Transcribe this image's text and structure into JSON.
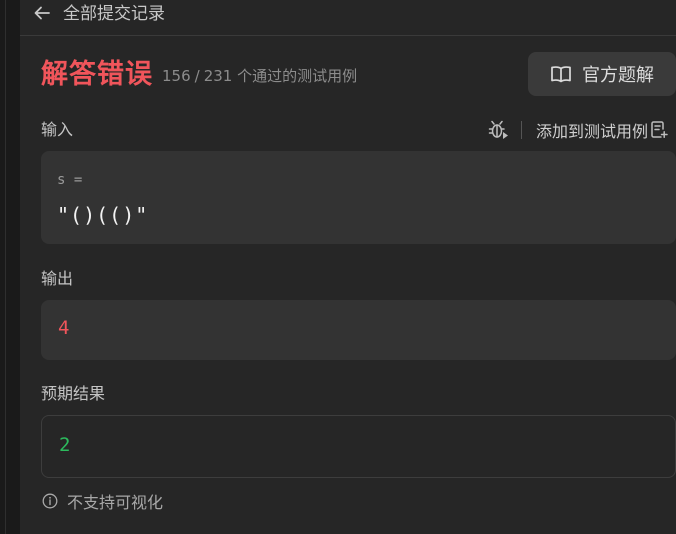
{
  "header": {
    "back_icon": "arrow-left-icon",
    "title": "全部提交记录"
  },
  "result": {
    "status": "解答错误",
    "passed": "156",
    "total": "231",
    "passed_suffix": "个通过的测试用例",
    "status_color": "#f0555b"
  },
  "official_solution": {
    "icon": "book-icon",
    "label": "官方题解"
  },
  "input_section": {
    "label": "输入",
    "debug_icon": "bug-icon",
    "add_label": "添加到测试用例",
    "add_icon": "document-add-icon",
    "var_name": "s =",
    "var_value": "\"()(()\""
  },
  "output_section": {
    "label": "输出",
    "value": "4",
    "color": "#f0555b"
  },
  "expected_section": {
    "label": "预期结果",
    "value": "2",
    "color": "#2cbb5d"
  },
  "note": {
    "icon": "info-icon",
    "text": "不支持可视化"
  }
}
